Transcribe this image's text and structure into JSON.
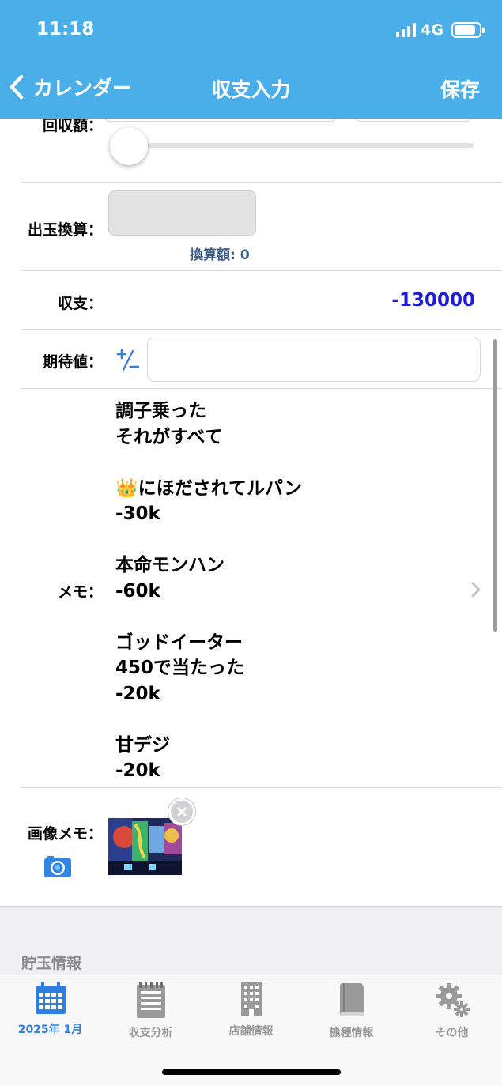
{
  "status_bar": {
    "time": "11:18",
    "network": "4G",
    "battery_level": 0.85
  },
  "nav": {
    "back_label": "カレンダー",
    "title": "収支入力",
    "save_label": "保存"
  },
  "form": {
    "recovery_label": "回収額：",
    "slider_level": 0,
    "conversion_label": "出玉換算：",
    "conversion_amount_label": "換算額:",
    "conversion_amount_value": "0",
    "balance_label": "収支：",
    "balance_value": "-130000",
    "expected_label": "期待値：",
    "expected_value": "",
    "memo_label": "メモ：",
    "memo_text": "調子乗った\nそれがすべて\n\n👑にほだされてルパン\n-30k\n\n本命モンハン\n-60k\n\nゴッドイーター\n450で当たった\n-20k\n\n甘デジ\n-20k",
    "image_memo_label": "画像メモ："
  },
  "section": {
    "title": "貯玉情報"
  },
  "tabs": [
    {
      "label": "2025年 1月",
      "icon": "calendar-icon",
      "active": true
    },
    {
      "label": "収支分析",
      "icon": "notepad-icon",
      "active": false
    },
    {
      "label": "店舗情報",
      "icon": "building-icon",
      "active": false
    },
    {
      "label": "機種情報",
      "icon": "book-icon",
      "active": false
    },
    {
      "label": "その他",
      "icon": "gears-icon",
      "active": false
    }
  ],
  "colors": {
    "header": "#4aaee8",
    "balance": "#1d1cd6",
    "accent": "#2f7fe0",
    "inactive": "#9a9a9a"
  }
}
